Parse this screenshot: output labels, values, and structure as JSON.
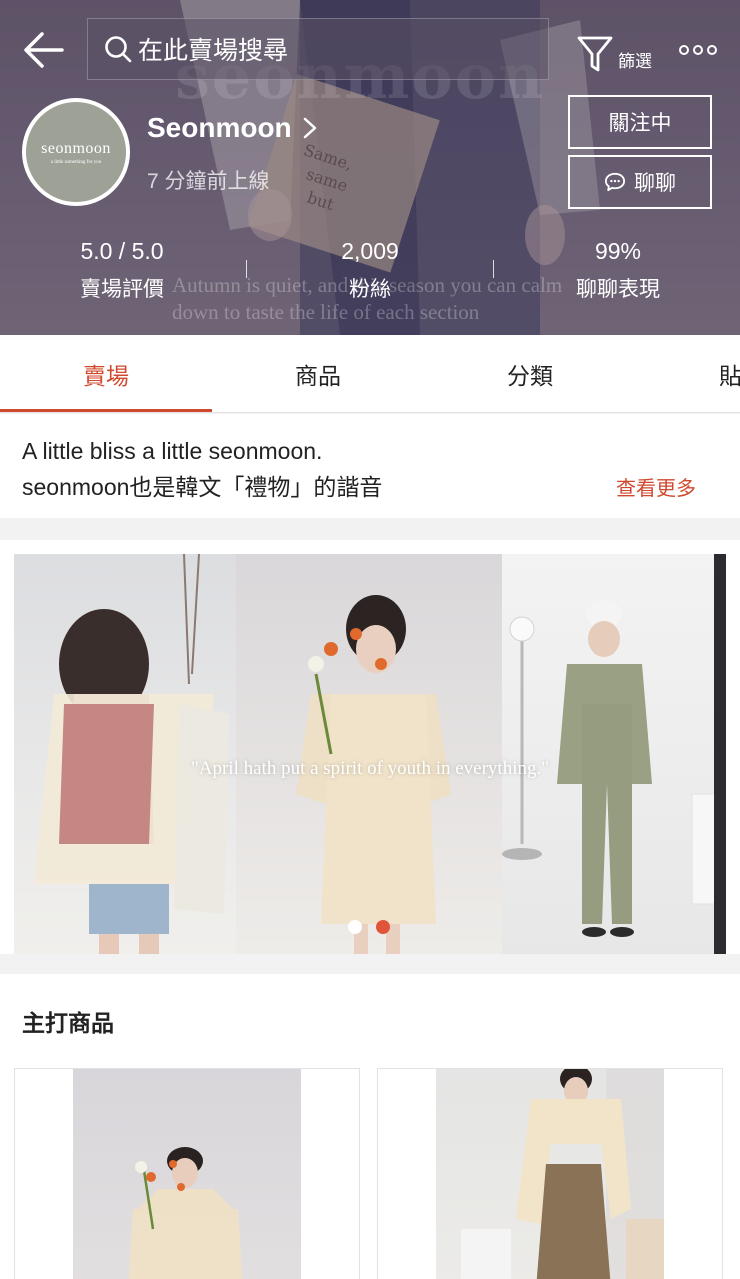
{
  "header": {
    "search_placeholder": "在此賣場搜尋",
    "filter_label": "篩選",
    "watermark_text": "seonmoon",
    "background_quote": "Autumn is quiet, and this season you can calm down to taste the life of each section"
  },
  "shop": {
    "avatar_name": "seonmoon",
    "avatar_tagline": "a little something for you",
    "name": "Seonmoon",
    "last_online": "7 分鐘前上線",
    "follow_label": "關注中",
    "chat_label": "聊聊"
  },
  "stats": [
    {
      "value": "5.0 / 5.0",
      "label": "賣場評價"
    },
    {
      "value": "2,009",
      "label": "粉絲"
    },
    {
      "value": "99%",
      "label": "聊聊表現"
    }
  ],
  "tabs": [
    {
      "label": "賣場",
      "active": true
    },
    {
      "label": "商品",
      "active": false
    },
    {
      "label": "分類",
      "active": false
    },
    {
      "label": "貼文",
      "active": false
    }
  ],
  "description": {
    "line1": "A little bliss a little seonmoon.",
    "line2": "seonmoon也是韓文「禮物」的諧音",
    "see_more": "查看更多"
  },
  "banner": {
    "quote": "\"April hath put a spirit of youth in everything.\"",
    "slide_count": 2,
    "active_slide": 2
  },
  "featured": {
    "title": "主打商品"
  },
  "colors": {
    "accent": "#d0492e",
    "dot_active": "#e0543a"
  }
}
